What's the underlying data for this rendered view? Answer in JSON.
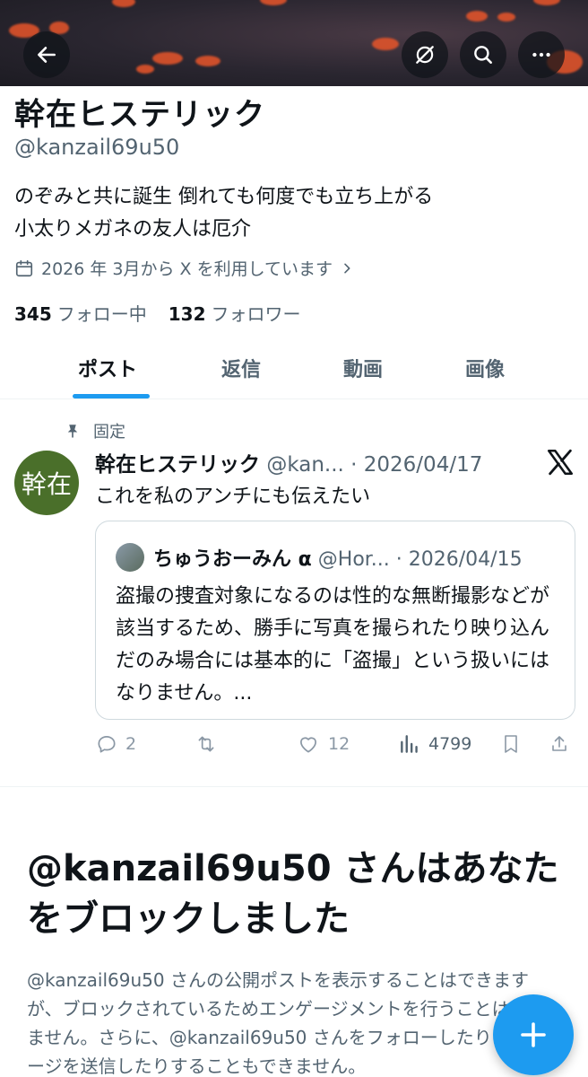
{
  "profile": {
    "name": "幹在ヒステリック",
    "handle": "@kanzail69u50",
    "bio_line1": "のぞみと共に誕生 倒れても何度でも立ち上がる",
    "bio_line2": "小太りメガネの友人は厄介",
    "joined": "2026 年 3月から X を利用しています",
    "following_count": "345",
    "following_label": "フォロー中",
    "followers_count": "132",
    "followers_label": "フォロワー"
  },
  "header": {
    "icons": [
      "back-arrow-icon",
      "grok-icon",
      "search-icon",
      "more-icon"
    ]
  },
  "tabs": [
    {
      "label": "ポスト",
      "active": true
    },
    {
      "label": "返信",
      "active": false
    },
    {
      "label": "動画",
      "active": false
    },
    {
      "label": "画像",
      "active": false
    }
  ],
  "pinned_post": {
    "pinned_label": "固定",
    "avatar_text": "幹在",
    "author": "幹在ヒステリック",
    "handle": "@kan...",
    "date": "· 2026/04/17",
    "text": "これを私のアンチにも伝えたい",
    "quote": {
      "author": "ちゅうおーみん α",
      "handle": "@Hor...",
      "date": "· 2026/04/15",
      "text": "盗撮の捜査対象になるのは性的な無断撮影などが該当するため、勝手に写真を撮られたり映り込んだのみ場合には基本的に「盗撮」という扱いにはなりません。..."
    },
    "replies": "2",
    "likes": "12",
    "views": "4799"
  },
  "blocked": {
    "title": "@kanzail69u50 さんはあなたをブロックしました",
    "description": "@kanzail69u50 さんの公開ポストを表示することはできますが、ブロックされているためエンゲージメントを行うことはできません。さらに、@kanzail69u50 さんをフォローしたりメッセージを送信したりすることもできません。"
  },
  "colors": {
    "accent": "#1d9bf0",
    "avatar_bg": "#4a6f2a",
    "muted_text": "#536471"
  }
}
